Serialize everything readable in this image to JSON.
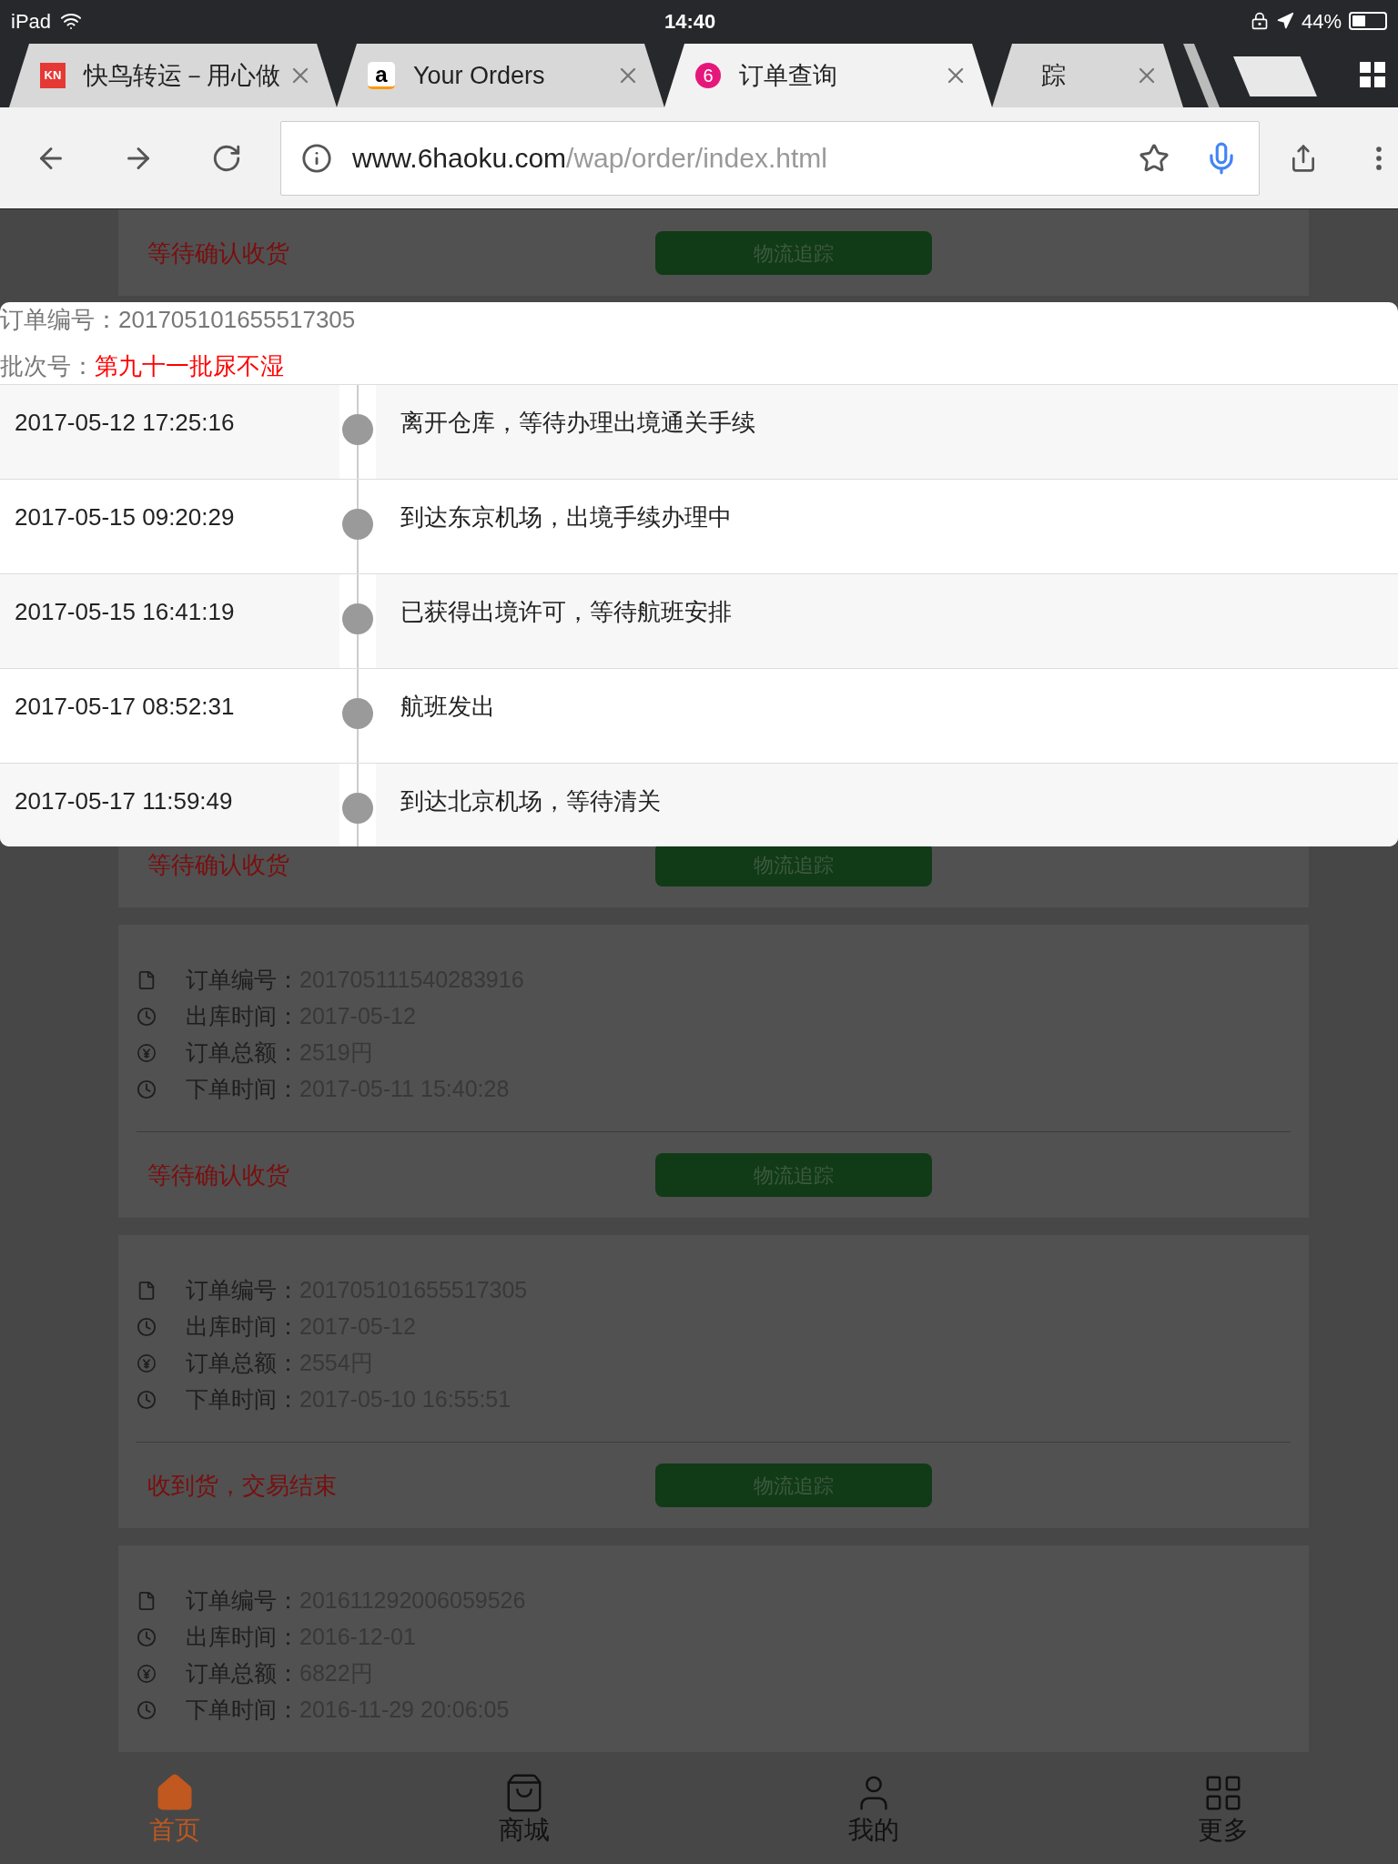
{
  "status_bar": {
    "device": "iPad",
    "time": "14:40",
    "battery": "44%"
  },
  "tabs": [
    {
      "title": "快鸟转运－用心做",
      "selected": false,
      "icon": {
        "kind": "square",
        "text": "KN"
      }
    },
    {
      "title": "Your Orders",
      "selected": false,
      "icon": {
        "kind": "amazon",
        "text": "a"
      }
    },
    {
      "title": "订单查询",
      "selected": true,
      "icon": {
        "kind": "circle",
        "text": "6"
      }
    },
    {
      "title": "踪",
      "selected": false
    }
  ],
  "toolbar": {
    "url_host": "www.6haoku.com",
    "url_path": "/wap/order/index.html"
  },
  "orders": [
    {
      "status": "等待确认收货",
      "button": "物流追踪"
    },
    {
      "status": "等待确认收货",
      "button": "物流追踪"
    },
    {
      "details": [
        {
          "kind": "doc",
          "label": "订单编号：",
          "value": "201705111540283916"
        },
        {
          "kind": "clock",
          "label": "出库时间：",
          "value": "2017-05-12"
        },
        {
          "kind": "yen",
          "label": "订单总额：",
          "value": "2519円"
        },
        {
          "kind": "clock",
          "label": "下单时间：",
          "value": "2017-05-11 15:40:28"
        }
      ],
      "status": "等待确认收货",
      "button": "物流追踪"
    },
    {
      "details": [
        {
          "kind": "doc",
          "label": "订单编号：",
          "value": "201705101655517305"
        },
        {
          "kind": "clock",
          "label": "出库时间：",
          "value": "2017-05-12"
        },
        {
          "kind": "yen",
          "label": "订单总额：",
          "value": "2554円"
        },
        {
          "kind": "clock",
          "label": "下单时间：",
          "value": "2017-05-10 16:55:51"
        }
      ],
      "status": "收到货，交易结束",
      "button": "物流追踪"
    },
    {
      "details": [
        {
          "kind": "doc",
          "label": "订单编号：",
          "value": "201611292006059526"
        },
        {
          "kind": "clock",
          "label": "出库时间：",
          "value": "2016-12-01"
        },
        {
          "kind": "yen",
          "label": "订单总额：",
          "value": "6822円"
        },
        {
          "kind": "clock",
          "label": "下单时间：",
          "value": "2016-11-29 20:06:05"
        }
      ]
    }
  ],
  "tracking_popup": {
    "order_label": "订单编号：",
    "order_number": "201705101655517305",
    "batch_label": "批次号：",
    "batch": "第九十一批尿不湿",
    "events": [
      {
        "time": "2017-05-12 17:25:16",
        "text": "离开仓库，等待办理出境通关手续"
      },
      {
        "time": "2017-05-15 09:20:29",
        "text": "到达东京机场，出境手续办理中"
      },
      {
        "time": "2017-05-15 16:41:19",
        "text": "已获得出境许可，等待航班安排"
      },
      {
        "time": "2017-05-17 08:52:31",
        "text": "航班发出"
      },
      {
        "time": "2017-05-17 11:59:49",
        "text": "到达北京机场，等待清关"
      }
    ]
  },
  "bottom_nav": [
    {
      "label": "首页",
      "kind": "home",
      "selected": true
    },
    {
      "label": "商城",
      "kind": "shop",
      "selected": false
    },
    {
      "label": "我的",
      "kind": "user",
      "selected": false
    },
    {
      "label": "更多",
      "kind": "more",
      "selected": false
    }
  ]
}
